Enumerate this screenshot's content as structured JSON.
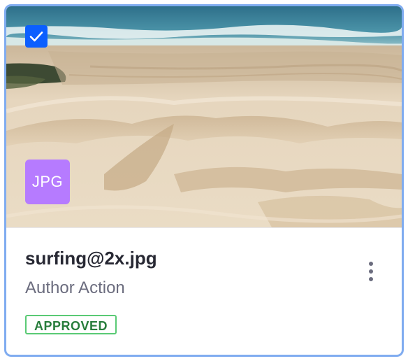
{
  "card": {
    "selected": true,
    "image_alt": "beach sand dunes by the ocean",
    "file_type": "JPG",
    "title": "surfing@2x.jpg",
    "subtitle": "Author Action",
    "status": "APPROVED",
    "colors": {
      "border_selected": "#80acf0",
      "checkbox": "#0b5fff",
      "badge": "#b67bff",
      "status_border": "#5aca75",
      "status_text": "#287d3c"
    }
  },
  "icons": {
    "checkbox": "check-icon",
    "menu": "ellipsis-v-icon"
  }
}
